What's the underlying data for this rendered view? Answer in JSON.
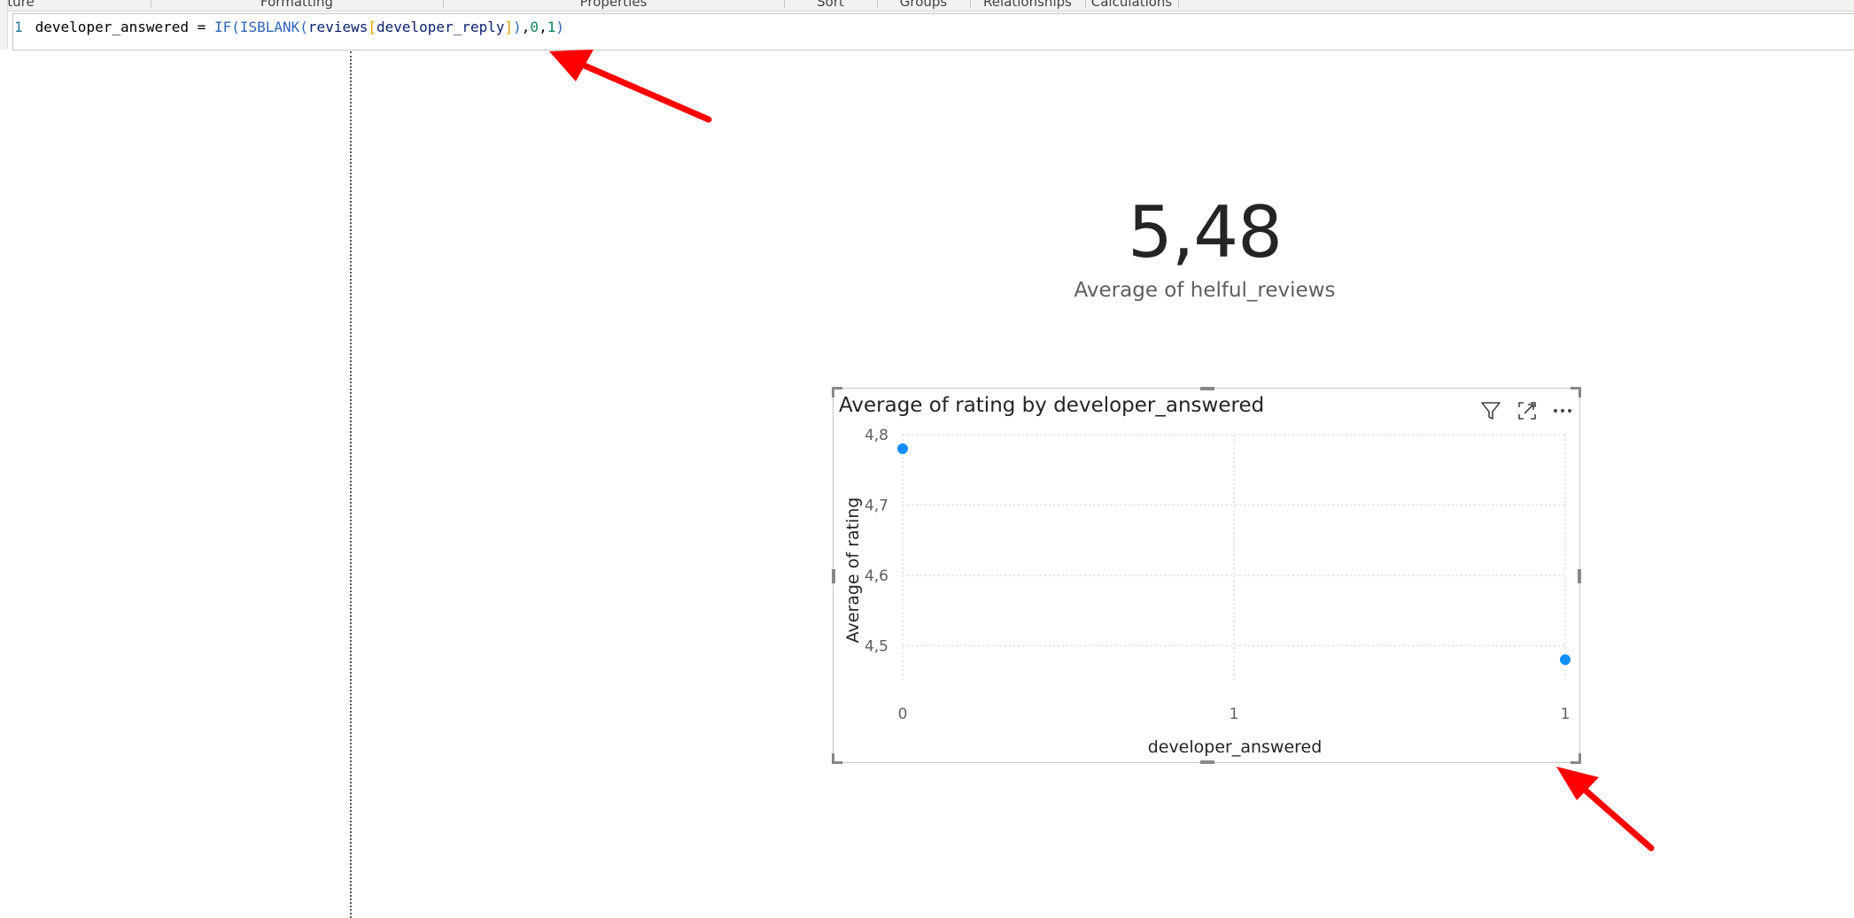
{
  "ribbon": {
    "groups": [
      "cture",
      "Formatting",
      "Properties",
      "Sort",
      "Groups",
      "Relationships",
      "Calculations"
    ]
  },
  "formula": {
    "line_number": "1",
    "measure_name": "developer_answered",
    "operator": " = ",
    "fn_if": "IF",
    "open1": "(",
    "fn_isblank": "ISBLANK",
    "open2": "(",
    "table": "reviews",
    "bracket_open": "[",
    "column": "developer_reply",
    "bracket_close": "]",
    "close2": ")",
    "comma1": ",",
    "arg_zero": "0",
    "comma2": ",",
    "arg_one": "1",
    "close1": ")"
  },
  "card": {
    "value": "5,48",
    "label": "Average of helful_reviews"
  },
  "visual": {
    "title": "Average of rating by developer_answered",
    "icons": [
      "filter-icon",
      "focus-mode-icon",
      "more-options-icon"
    ]
  },
  "chart_data": {
    "type": "scatter",
    "title": "Average of rating by developer_answered",
    "xlabel": "developer_answered",
    "ylabel": "Average of rating",
    "x_tick_labels": [
      "0",
      "1",
      "1"
    ],
    "y_tick_labels": [
      "4,8",
      "4,7",
      "4,6",
      "4,5"
    ],
    "y_ticks": [
      4.8,
      4.7,
      4.6,
      4.5
    ],
    "xlim": [
      0,
      1
    ],
    "ylim": [
      4.45,
      4.8
    ],
    "grid": true,
    "series": [
      {
        "color": "#118DFF",
        "points": [
          {
            "x": 0,
            "y": 4.78
          },
          {
            "x": 1,
            "y": 4.48
          }
        ]
      }
    ]
  },
  "colors": {
    "accent": "#118DFF",
    "annotation_arrow": "#ff0000"
  }
}
